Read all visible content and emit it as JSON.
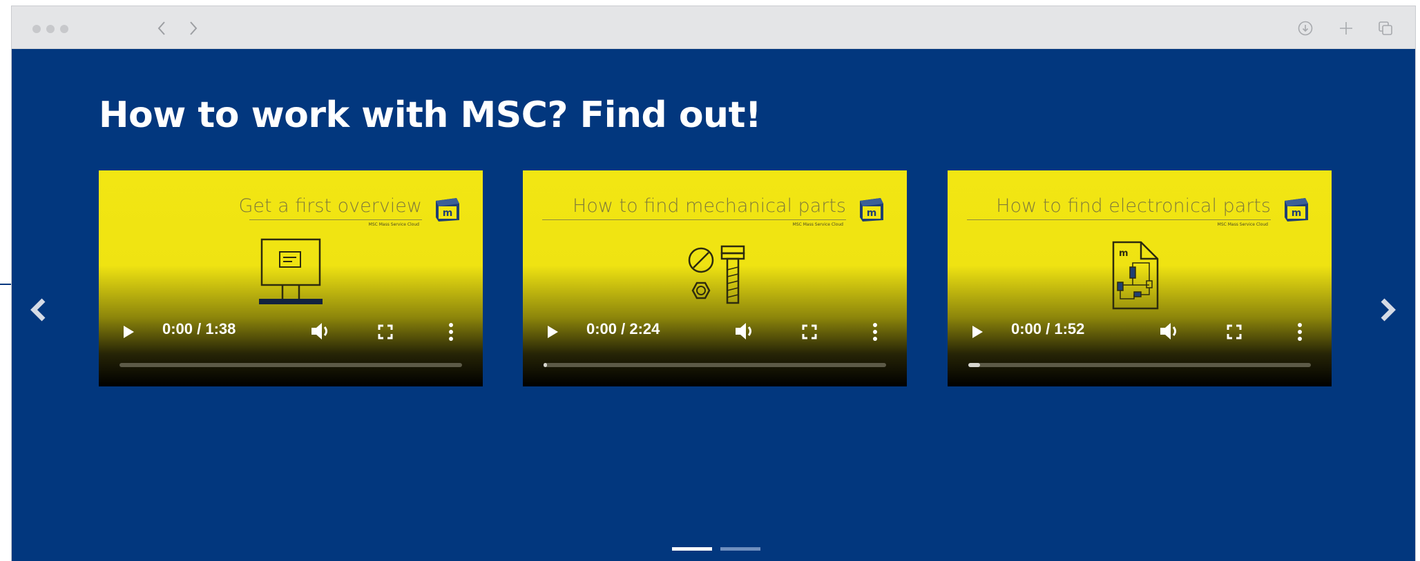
{
  "page": {
    "title": "How to work with MSC? Find out!"
  },
  "colors": {
    "background": "#02377e",
    "video_yellow": "#f2e613",
    "indicator_active": "#ffffff",
    "indicator_inactive": "#6f8fbf"
  },
  "browser": {
    "back_icon": "chevron-left-icon",
    "forward_icon": "chevron-right-icon",
    "toolbar_icons": [
      "download-icon",
      "plus-icon",
      "tabs-icon"
    ]
  },
  "videos": [
    {
      "caption": "Get a first overview",
      "subcaption": "MSC Mass Service Cloud",
      "time": "0:00 / 1:38",
      "progress": 0.0,
      "illustration": "monitor-icon"
    },
    {
      "caption": "How to find mechanical parts",
      "subcaption": "MSC Mass Service Cloud",
      "time": "0:00 / 2:24",
      "progress": 0.01,
      "illustration": "bolt-and-nut-icon"
    },
    {
      "caption": "How to find electronical parts",
      "subcaption": "MSC Mass Service Cloud",
      "time": "0:00 / 1:52",
      "progress": 0.035,
      "illustration": "circuit-document-icon"
    }
  ],
  "carousel": {
    "slides": 2,
    "active_slide": 1,
    "prev_icon": "chevron-left-icon",
    "next_icon": "chevron-right-icon"
  }
}
